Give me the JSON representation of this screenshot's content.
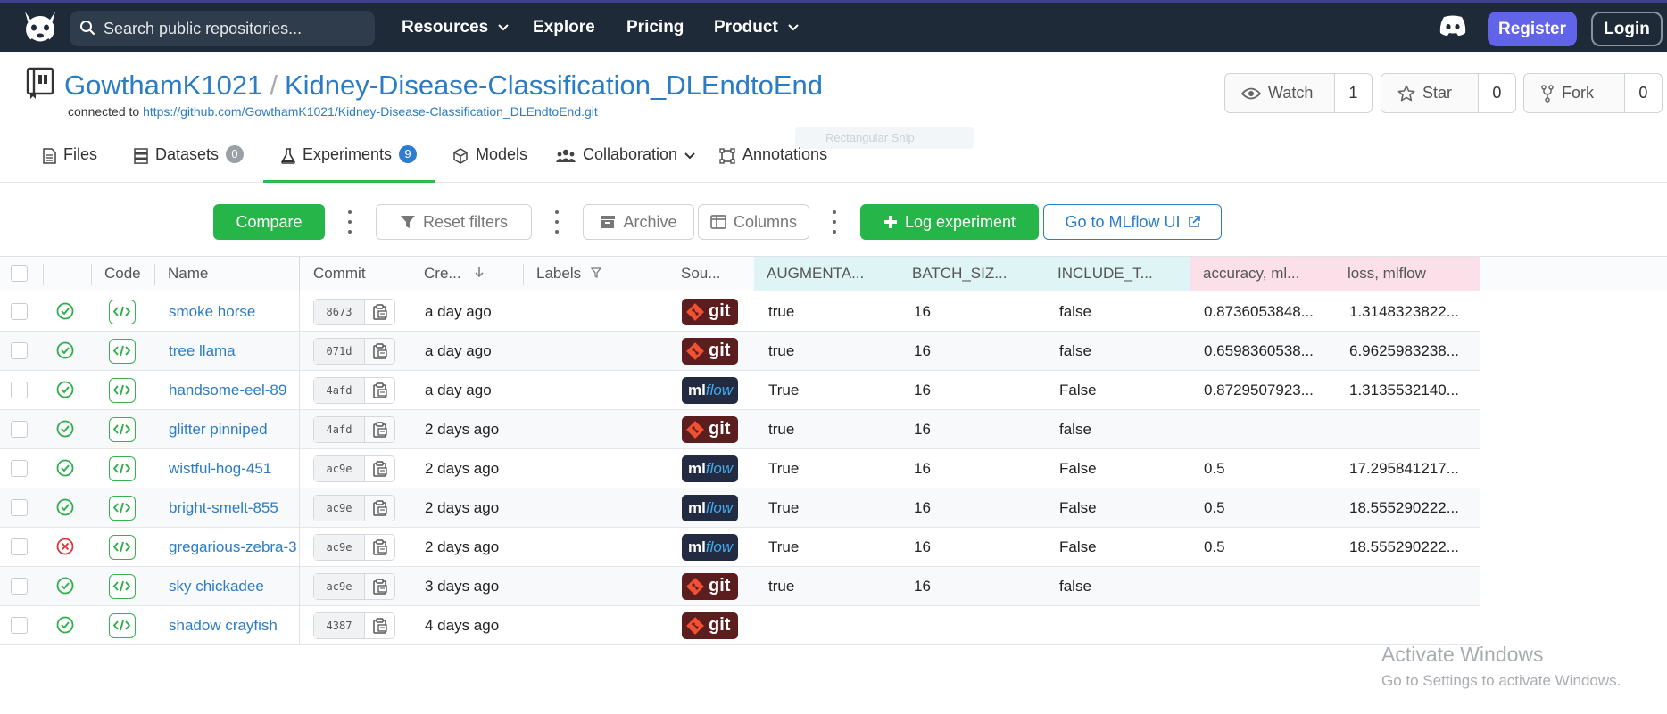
{
  "nav": {
    "search_placeholder": "Search public repositories...",
    "links": [
      "Resources",
      "Explore",
      "Pricing",
      "Product"
    ],
    "register_label": "Register",
    "login_label": "Login"
  },
  "repo": {
    "owner": "GowthamK1021",
    "separator": "/",
    "name": "Kidney-Disease-Classification_DLEndtoEnd",
    "connected_prefix": "connected to",
    "connected_url": "https://github.com/GowthamK1021/Kidney-Disease-Classification_DLEndtoEnd.git",
    "watch_label": "Watch",
    "watch_count": "1",
    "star_label": "Star",
    "star_count": "0",
    "fork_label": "Fork",
    "fork_count": "0"
  },
  "tabs": [
    {
      "label": "Files",
      "badge": ""
    },
    {
      "label": "Datasets",
      "badge": "0"
    },
    {
      "label": "Experiments",
      "badge": "9"
    },
    {
      "label": "Models",
      "badge": ""
    },
    {
      "label": "Collaboration",
      "badge": ""
    },
    {
      "label": "Annotations",
      "badge": ""
    }
  ],
  "ghost_tooltip": "Rectangular Snip",
  "toolbar": {
    "compare": "Compare",
    "reset_filters": "Reset filters",
    "archive": "Archive",
    "columns": "Columns",
    "log_experiment": "Log experiment",
    "mlflow_ui": "Go to MLflow UI"
  },
  "columns": [
    "Code",
    "Name",
    "Commit",
    "Cre...",
    "Labels",
    "Sou...",
    "AUGMENTA...",
    "BATCH_SIZ...",
    "INCLUDE_T...",
    "accuracy, ml...",
    "loss, mlflow"
  ],
  "rows": [
    {
      "status": "ok",
      "name": "smoke horse",
      "commit": "8673",
      "created": "a day ago",
      "source": "git",
      "aug": "true",
      "batch": "16",
      "inc": "false",
      "acc": "0.8736053848...",
      "loss": "1.3148323822..."
    },
    {
      "status": "ok",
      "name": "tree llama",
      "commit": "071d",
      "created": "a day ago",
      "source": "git",
      "aug": "true",
      "batch": "16",
      "inc": "false",
      "acc": "0.6598360538...",
      "loss": "6.9625983238..."
    },
    {
      "status": "ok",
      "name": "handsome-eel-89",
      "commit": "4afd",
      "created": "a day ago",
      "source": "mlflow",
      "aug": "True",
      "batch": "16",
      "inc": "False",
      "acc": "0.8729507923...",
      "loss": "1.3135532140..."
    },
    {
      "status": "ok",
      "name": "glitter pinniped",
      "commit": "4afd",
      "created": "2 days ago",
      "source": "git",
      "aug": "true",
      "batch": "16",
      "inc": "false",
      "acc": "",
      "loss": ""
    },
    {
      "status": "ok",
      "name": "wistful-hog-451",
      "commit": "ac9e",
      "created": "2 days ago",
      "source": "mlflow",
      "aug": "True",
      "batch": "16",
      "inc": "False",
      "acc": "0.5",
      "loss": "17.295841217..."
    },
    {
      "status": "ok",
      "name": "bright-smelt-855",
      "commit": "ac9e",
      "created": "2 days ago",
      "source": "mlflow",
      "aug": "True",
      "batch": "16",
      "inc": "False",
      "acc": "0.5",
      "loss": "18.555290222..."
    },
    {
      "status": "fail",
      "name": "gregarious-zebra-3",
      "commit": "ac9e",
      "created": "2 days ago",
      "source": "mlflow",
      "aug": "True",
      "batch": "16",
      "inc": "False",
      "acc": "0.5",
      "loss": "18.555290222..."
    },
    {
      "status": "ok",
      "name": "sky chickadee",
      "commit": "ac9e",
      "created": "3 days ago",
      "source": "git",
      "aug": "true",
      "batch": "16",
      "inc": "false",
      "acc": "",
      "loss": ""
    },
    {
      "status": "ok",
      "name": "shadow crayfish",
      "commit": "4387",
      "created": "4 days ago",
      "source": "git",
      "aug": "",
      "batch": "",
      "inc": "",
      "acc": "",
      "loss": ""
    }
  ],
  "source_labels": {
    "git": "git",
    "ml": "ml",
    "flow": "flow"
  },
  "watermark": {
    "title": "Activate Windows",
    "subtitle": "Go to Settings to activate Windows."
  },
  "colors": {
    "nav_bg": "#1e2a38",
    "accent_green": "#25b549",
    "link_blue": "#2b7cc4",
    "register": "#6163e8"
  }
}
